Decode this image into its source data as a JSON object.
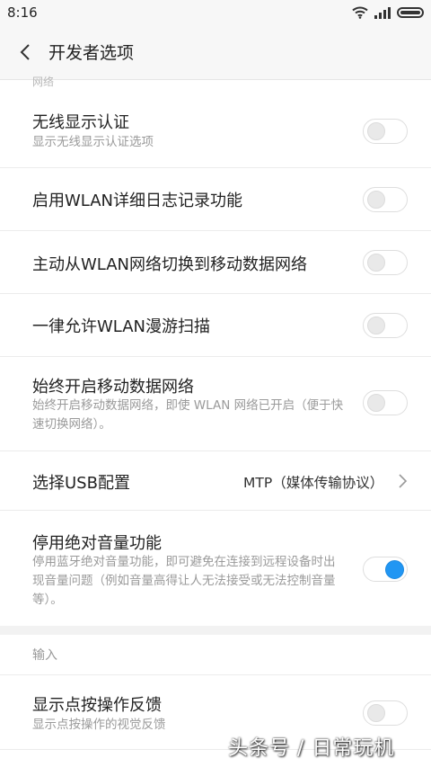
{
  "status_bar": {
    "time": "8:16"
  },
  "header": {
    "title": "开发者选项"
  },
  "section_peek": "网络",
  "rows": [
    {
      "title": "无线显示认证",
      "subtitle": "显示无线显示认证选项",
      "toggle_on": false
    },
    {
      "title": "启用WLAN详细日志记录功能",
      "toggle_on": false
    },
    {
      "title": "主动从WLAN网络切换到移动数据网络",
      "toggle_on": false
    },
    {
      "title": "一律允许WLAN漫游扫描",
      "toggle_on": false
    },
    {
      "title": "始终开启移动数据网络",
      "subtitle": "始终开启移动数据网络，即使 WLAN 网络已开启（便于快速切换网络）。",
      "toggle_on": false
    },
    {
      "title": "选择USB配置",
      "value": "MTP（媒体传输协议）"
    },
    {
      "title": "停用绝对音量功能",
      "subtitle": "停用蓝牙绝对音量功能，即可避免在连接到远程设备时出现音量问题（例如音量高得让人无法接受或无法控制音量等）。",
      "toggle_on": true
    }
  ],
  "input_section": {
    "header": "输入",
    "rows": [
      {
        "title": "显示点按操作反馈",
        "subtitle": "显示点按操作的视觉反馈",
        "toggle_on": false
      }
    ]
  },
  "watermark": "头条号 / 日常玩机",
  "colors": {
    "accent": "#2196f3",
    "background": "#ffffff",
    "subtitle": "#9a9a9a"
  },
  "icons": {
    "back": "chevron-left-icon",
    "wifi": "wifi-icon",
    "signal": "signal-icon",
    "battery": "battery-icon",
    "row_chevron": "chevron-right-icon"
  }
}
